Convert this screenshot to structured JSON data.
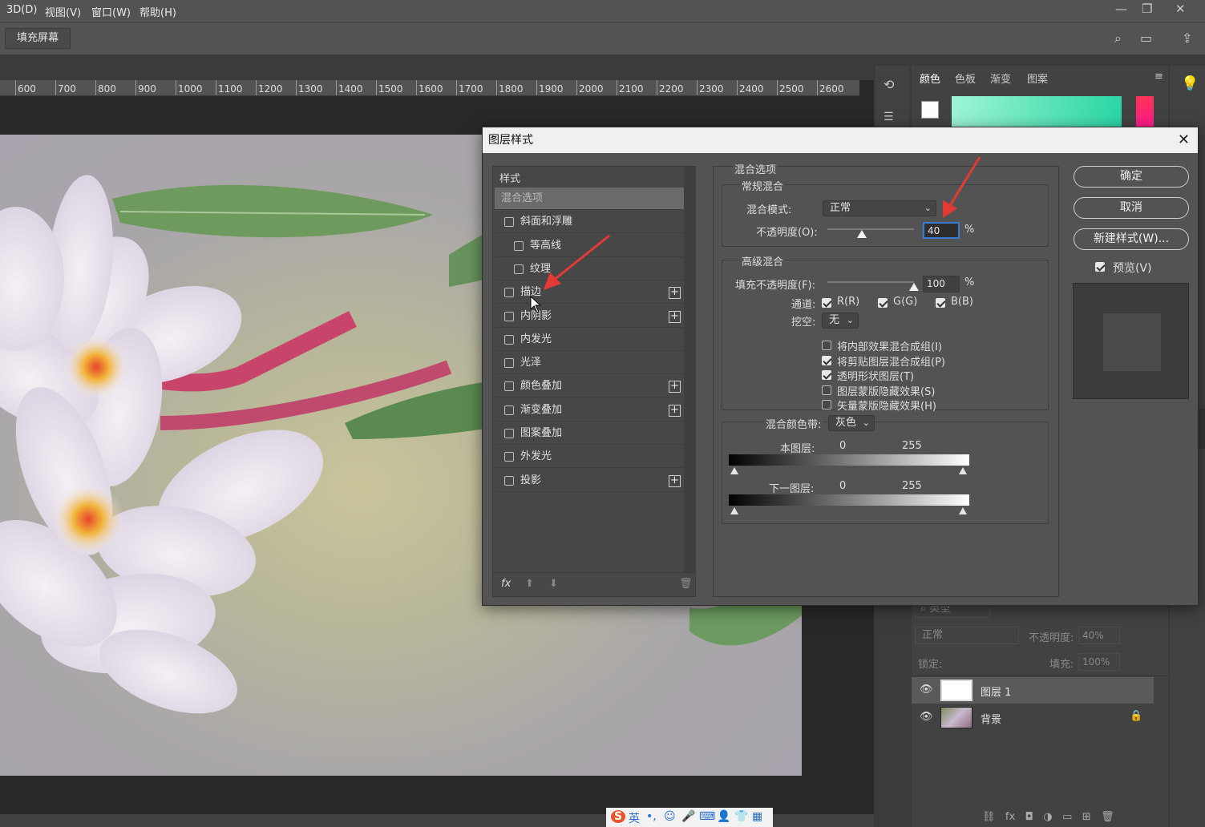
{
  "menu": [
    "3D(D)",
    "视图(V)",
    "窗口(W)",
    "帮助(H)"
  ],
  "window_controls": {
    "min": "—",
    "restore": "❐",
    "close": "✕"
  },
  "options_bar": {
    "fill_screen": "填充屏幕"
  },
  "ruler": [
    "600",
    "700",
    "800",
    "900",
    "1000",
    "1100",
    "1200",
    "1300",
    "1400",
    "1500",
    "1600",
    "1700",
    "1800",
    "1900",
    "2000",
    "2100",
    "2200",
    "2300",
    "2400",
    "2500",
    "2600"
  ],
  "color_panel": {
    "tabs": [
      "颜色",
      "色板",
      "渐变",
      "图案"
    ],
    "gradient_colors": [
      "#2ad6a4",
      "#9ef5d4"
    ],
    "accent": "#ff1a8c"
  },
  "layers_panel": {
    "filter_kind": "类型",
    "blend_mode": "正常",
    "opacity_label": "不透明度:",
    "opacity_value": "40%",
    "lock_label": "锁定:",
    "fill_label": "填充:",
    "fill_value": "100%",
    "layers": [
      {
        "name": "图层 1",
        "selected": true
      },
      {
        "name": "背景",
        "locked": true
      }
    ]
  },
  "dialog": {
    "title": "图层样式",
    "close": "✕",
    "styles_header": "样式",
    "styles": [
      {
        "label": "混合选项",
        "active": true
      },
      {
        "label": "斜面和浮雕",
        "checkbox": true
      },
      {
        "label": "等高线",
        "checkbox": true,
        "indent": true
      },
      {
        "label": "纹理",
        "checkbox": true,
        "indent": true
      },
      {
        "label": "描边",
        "checkbox": true,
        "plus": true
      },
      {
        "label": "内阴影",
        "checkbox": true,
        "plus": true
      },
      {
        "label": "内发光",
        "checkbox": true
      },
      {
        "label": "光泽",
        "checkbox": true
      },
      {
        "label": "颜色叠加",
        "checkbox": true,
        "plus": true
      },
      {
        "label": "渐变叠加",
        "checkbox": true,
        "plus": true
      },
      {
        "label": "图案叠加",
        "checkbox": true
      },
      {
        "label": "外发光",
        "checkbox": true
      },
      {
        "label": "投影",
        "checkbox": true,
        "plus": true
      }
    ],
    "list_footer": {
      "fx": "fx",
      "up": "⬆",
      "down": "⬇",
      "trash": "🗑"
    },
    "blend_options": {
      "section_title": "混合选项",
      "general_title": "常规混合",
      "blend_mode_label": "混合模式:",
      "blend_mode_value": "正常",
      "opacity_label": "不透明度(O):",
      "opacity_value": "40",
      "opacity_fraction": 0.4,
      "percent": "%",
      "advanced_title": "高级混合",
      "fill_opacity_label": "填充不透明度(F):",
      "fill_opacity_value": "100",
      "fill_opacity_fraction": 1.0,
      "channels_label": "通道:",
      "channels": [
        {
          "label": "R(R)",
          "checked": true
        },
        {
          "label": "G(G)",
          "checked": true
        },
        {
          "label": "B(B)",
          "checked": true
        }
      ],
      "knockout_label": "挖空:",
      "knockout_value": "无",
      "options": [
        {
          "label": "将内部效果混合成组(I)",
          "checked": false
        },
        {
          "label": "将剪贴图层混合成组(P)",
          "checked": true
        },
        {
          "label": "透明形状图层(T)",
          "checked": true
        },
        {
          "label": "图层蒙版隐藏效果(S)",
          "checked": false
        },
        {
          "label": "矢量蒙版隐藏效果(H)",
          "checked": false
        }
      ],
      "blend_if_label": "混合颜色带:",
      "blend_if_value": "灰色",
      "this_layer_label": "本图层:",
      "this_layer_min": "0",
      "this_layer_max": "255",
      "underlying_label": "下一图层:",
      "underlying_min": "0",
      "underlying_max": "255"
    },
    "buttons": {
      "ok": "确定",
      "cancel": "取消",
      "new_style": "新建样式(W)...",
      "preview": "预览(V)"
    },
    "preview_checked": true
  },
  "ime": {
    "items": [
      "S",
      "英",
      "•,",
      "☺",
      "🎤",
      "⌨",
      "👤",
      "👕",
      "▦"
    ]
  }
}
